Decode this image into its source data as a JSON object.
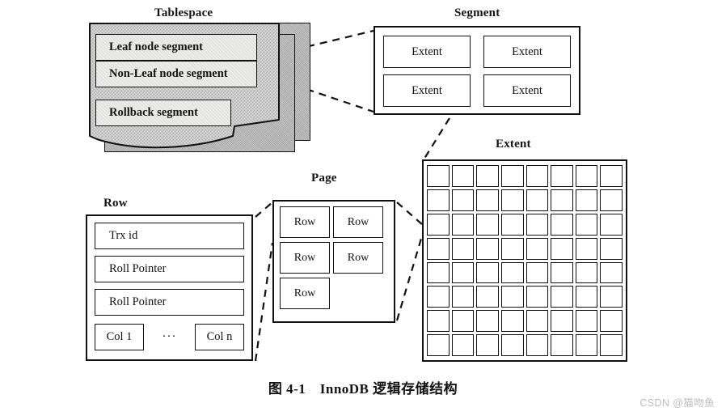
{
  "figure": {
    "caption": "图 4-1　InnoDB 逻辑存储结构",
    "watermark": "CSDN @猫吻鱼",
    "background_color": "#ffffff",
    "stroke_color": "#111111"
  },
  "tablespace": {
    "label": "Tablespace",
    "sheet_count": 3,
    "fill_color": "#c9c9c9",
    "segment_fill_color": "#ececeb",
    "segments": [
      {
        "label": "Leaf node segment"
      },
      {
        "label": "Non-Leaf node segment"
      },
      {
        "label": "Rollback segment"
      }
    ]
  },
  "segment": {
    "label": "Segment",
    "extents": [
      {
        "label": "Extent"
      },
      {
        "label": "Extent"
      },
      {
        "label": "Extent"
      },
      {
        "label": "Extent"
      }
    ]
  },
  "extent": {
    "label": "Extent",
    "grid_columns": 8,
    "grid_rows": 8,
    "page_count": 64
  },
  "page": {
    "label": "Page",
    "rows": [
      {
        "label": "Row"
      },
      {
        "label": "Row"
      },
      {
        "label": "Row"
      },
      {
        "label": "Row"
      },
      {
        "label": "Row"
      }
    ]
  },
  "row": {
    "label": "Row",
    "fields": [
      {
        "label": "Trx id"
      },
      {
        "label": "Roll Pointer"
      },
      {
        "label": "Roll Pointer"
      }
    ],
    "columns": {
      "first": "Col 1",
      "ellipsis": "···",
      "last": "Col n"
    }
  },
  "connectors": [
    {
      "from": "tablespace",
      "to": "segment",
      "style": "dashed"
    },
    {
      "from": "tablespace",
      "to": "segment",
      "style": "dashed"
    },
    {
      "from": "segment",
      "to": "extent",
      "style": "dashed"
    },
    {
      "from": "page",
      "to": "extent",
      "style": "dashed"
    },
    {
      "from": "page",
      "to": "extent",
      "style": "dashed"
    },
    {
      "from": "row",
      "to": "page",
      "style": "dashed"
    },
    {
      "from": "row",
      "to": "page",
      "style": "dashed"
    }
  ]
}
